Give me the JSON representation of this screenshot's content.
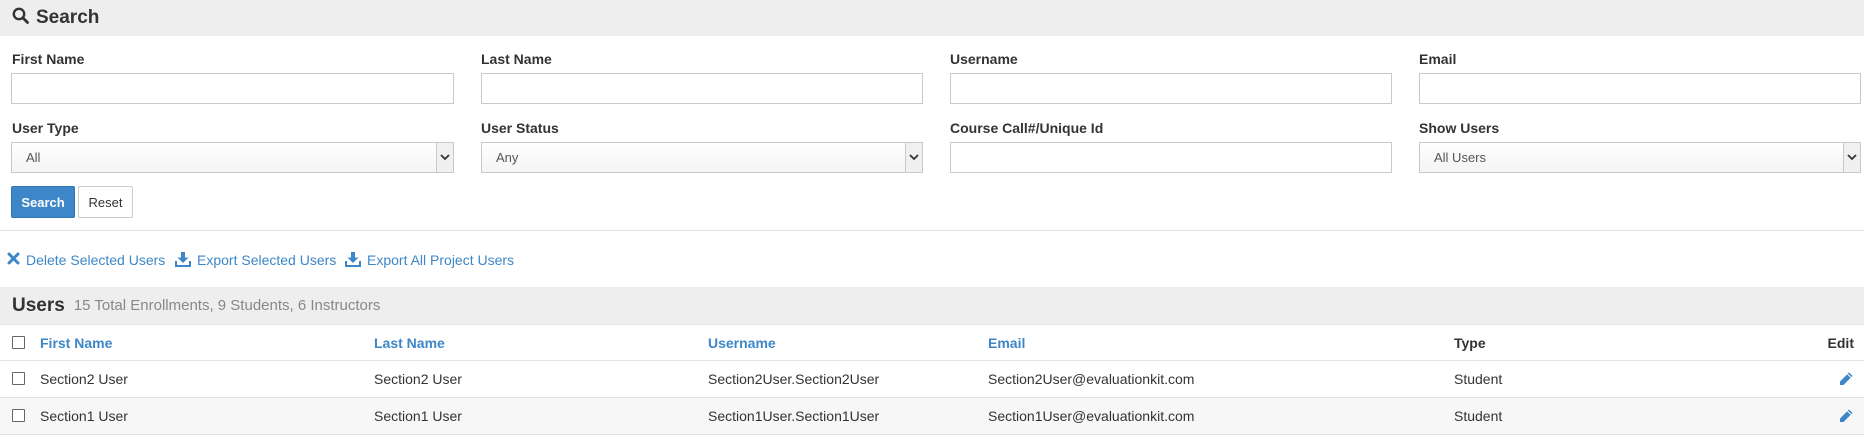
{
  "search": {
    "title": "Search",
    "fields": {
      "first_name": {
        "label": "First Name",
        "value": ""
      },
      "last_name": {
        "label": "Last Name",
        "value": ""
      },
      "username": {
        "label": "Username",
        "value": ""
      },
      "email": {
        "label": "Email",
        "value": ""
      },
      "user_type": {
        "label": "User Type",
        "value": "All"
      },
      "user_status": {
        "label": "User Status",
        "value": "Any"
      },
      "course_id": {
        "label": "Course Call#/Unique Id",
        "value": ""
      },
      "show_users": {
        "label": "Show Users",
        "value": "All Users"
      }
    },
    "search_button": "Search",
    "reset_button": "Reset"
  },
  "actions": {
    "delete_selected": "Delete Selected Users",
    "export_selected": "Export Selected Users",
    "export_all": "Export All Project Users"
  },
  "users": {
    "title": "Users",
    "summary": "15 Total Enrollments, 9 Students, 6 Instructors",
    "columns": {
      "first_name": "First Name",
      "last_name": "Last Name",
      "username": "Username",
      "email": "Email",
      "type": "Type",
      "edit": "Edit"
    },
    "rows": [
      {
        "first_name": "Section2 User",
        "last_name": "Section2 User",
        "username": "Section2User.Section2User",
        "email": "Section2User@evaluationkit.com",
        "type": "Student"
      },
      {
        "first_name": "Section1 User",
        "last_name": "Section1 User",
        "username": "Section1User.Section1User",
        "email": "Section1User@evaluationkit.com",
        "type": "Student"
      }
    ]
  },
  "colors": {
    "accent": "#3d87c8",
    "header_bg": "#eeeeee",
    "muted_text": "#888888"
  },
  "icons": {
    "search": "magnifier-icon",
    "delete": "x-icon",
    "export": "download-icon",
    "edit": "pencil-icon",
    "dropdown": "chevron-down-icon"
  }
}
